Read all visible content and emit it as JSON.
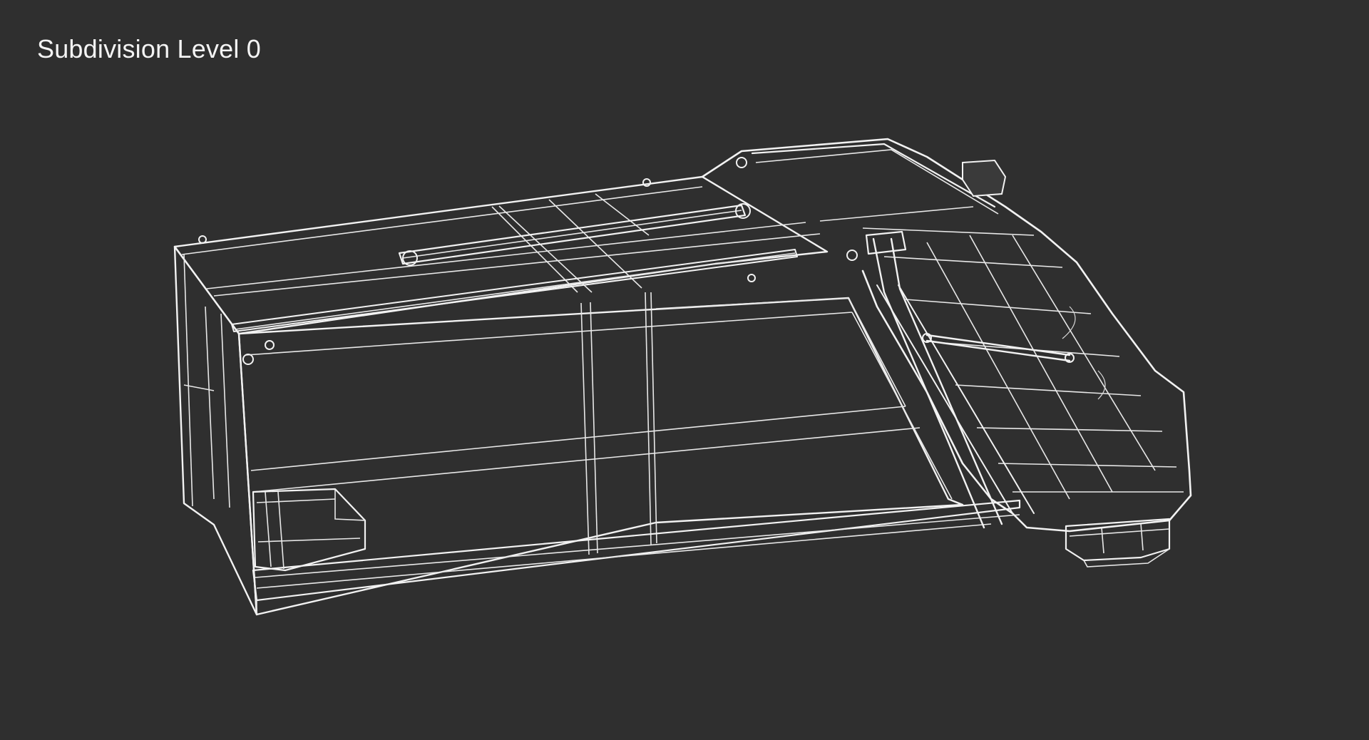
{
  "viewport": {
    "caption": "Subdivision Level 0",
    "background_color": "#2f2f2f",
    "wire_color": "#f2f2f2"
  }
}
